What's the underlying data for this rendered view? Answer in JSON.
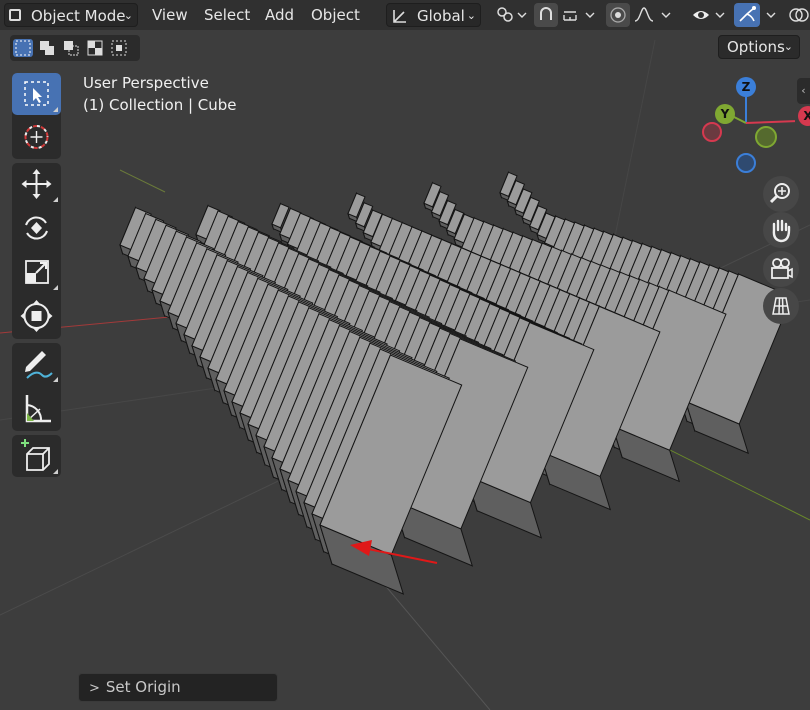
{
  "header": {
    "mode_label": "Object Mode",
    "menus": [
      "View",
      "Select",
      "Add",
      "Object"
    ],
    "transform_orientation": "Global",
    "options_label": "Options"
  },
  "viewport": {
    "view_name": "User Perspective",
    "collection_label": "(1) Collection | Cube"
  },
  "gizmo": {
    "z": "Z",
    "y": "Y",
    "x": "X"
  },
  "last_operator": {
    "label": "Set Origin",
    "chevron": ">"
  },
  "colors": {
    "accent": "#4772b3",
    "x_axis": "#d6394f",
    "y_axis": "#7fa832",
    "z_axis": "#3b7fd9",
    "annotation_arrow": "#e01818"
  },
  "icons": [
    "editor-type-icon",
    "chevron-down-icon",
    "transform-orientation-icon",
    "pivot-point-icon",
    "snap-icon",
    "snap-increment-icon",
    "proportional-editing-icon",
    "falloff-icon",
    "visibility-icon",
    "gizmo-icon",
    "select-box-icon",
    "cursor-icon",
    "move-icon",
    "rotate-icon",
    "scale-icon",
    "transform-icon",
    "annotate-icon",
    "measure-icon",
    "add-cube-icon",
    "zoom-icon",
    "hand-icon",
    "camera-icon",
    "grid-view-icon"
  ]
}
